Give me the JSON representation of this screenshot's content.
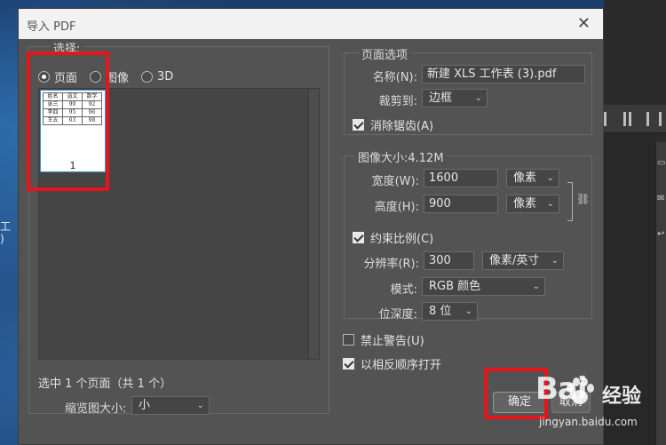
{
  "dialog": {
    "title": "导入 PDF",
    "close_glyph": "✕"
  },
  "select": {
    "legend": "选择:",
    "radios": [
      {
        "label": "页面",
        "checked": true
      },
      {
        "label": "图像",
        "checked": false
      },
      {
        "label": "3D",
        "checked": false
      }
    ],
    "thumbnail": {
      "table": [
        [
          "姓名",
          "语文",
          "数学"
        ],
        [
          "张三",
          "90",
          "92"
        ],
        [
          "李四",
          "95",
          "96"
        ],
        [
          "王五",
          "63",
          "98"
        ]
      ],
      "page_number": "1"
    },
    "selection_info": "选中 1 个页面（共 1 个）",
    "thumb_size_label": "缩览图大小:",
    "thumb_size_value": "小"
  },
  "page_options": {
    "legend": "页面选项",
    "name_label": "名称(N):",
    "name_value": "新建 XLS 工作表 (3).pdf",
    "crop_label": "裁剪到:",
    "crop_value": "边框",
    "anti_alias_label": "消除锯齿(A)",
    "anti_alias_checked": true
  },
  "image_size": {
    "legend": "图像大小:4.12M",
    "width_label": "宽度(W):",
    "width_value": "1600",
    "width_unit": "像素",
    "height_label": "高度(H):",
    "height_value": "900",
    "height_unit": "像素",
    "constrain_label": "约束比例(C)",
    "constrain_checked": true,
    "resolution_label": "分辨率(R):",
    "resolution_value": "300",
    "resolution_unit": "像素/英寸",
    "mode_label": "模式:",
    "mode_value": "RGB 颜色",
    "bit_depth_label": "位深度:",
    "bit_depth_value": "8 位"
  },
  "options": {
    "suppress_warnings_label": "禁止警告(U)",
    "suppress_warnings_checked": false,
    "reverse_order_label": "以相反顺序打开",
    "reverse_order_checked": true
  },
  "buttons": {
    "ok": "确定",
    "cancel": "取消"
  },
  "background": {
    "desktop_text_1": "工",
    "desktop_text_2": ")"
  },
  "watermark": {
    "logo": "Bai",
    "brand": "经验",
    "url": "jingyan.baidu.com"
  },
  "colors": {
    "dialog_bg": "#535353",
    "annotation_red": "#e8141b",
    "titlebar_bg": "#f2f2f2"
  }
}
